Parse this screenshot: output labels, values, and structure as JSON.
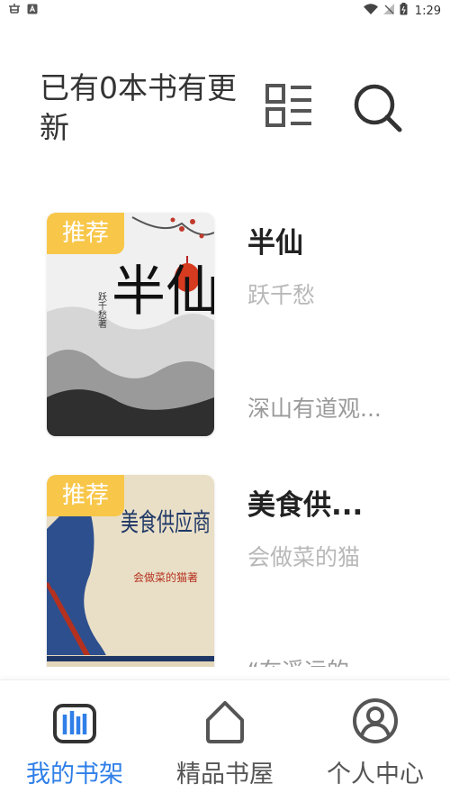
{
  "status_bar": {
    "time": "1:29",
    "icons": [
      "bug-icon",
      "a-notification-icon",
      "wifi-icon",
      "no-signal-icon",
      "battery-icon"
    ]
  },
  "header": {
    "title": "已有0本书有更新",
    "icons": [
      "list-layout-icon",
      "search-icon"
    ]
  },
  "books": [
    {
      "tag": "推荐",
      "title": "半仙",
      "author": "跃千愁",
      "desc": "深山有道观..."
    },
    {
      "tag": "推荐",
      "title": "美食供...",
      "author": "会做菜的猫",
      "desc": "“在遥远的"
    }
  ],
  "covers": [
    {
      "title_art": "半仙",
      "author_art": "跃千愁著"
    },
    {
      "title_art": "美食供应商",
      "author_art": "会做菜的猫著"
    }
  ],
  "tabs": [
    {
      "label": "我的书架",
      "icon": "bookshelf-icon",
      "active": true
    },
    {
      "label": "精品书屋",
      "icon": "house-icon",
      "active": false
    },
    {
      "label": "个人中心",
      "icon": "user-circle-icon",
      "active": false
    }
  ],
  "colors": {
    "accent": "#2f7fe8",
    "tag_bg": "#f8c74a",
    "icon_gray": "#555555",
    "author_gray": "#b8b8b8"
  }
}
